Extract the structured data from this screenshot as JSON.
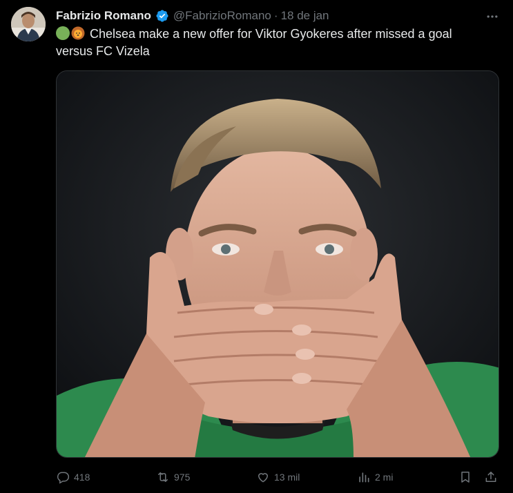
{
  "author": {
    "name": "Fabrizio Romano",
    "handle": "@FabrizioRomano",
    "separator": "·",
    "date": "18 de jan",
    "verified": true,
    "avatar_icon": "avatar-photo"
  },
  "tweet": {
    "emoji": [
      "green-circle",
      "lion-face"
    ],
    "text": "Chelsea make a new offer for Viktor Gyokeres after missed a goal versus FC Vizela",
    "media_description_icon": "player-photo"
  },
  "actions": {
    "replies": "418",
    "retweets": "975",
    "likes": "13 mil",
    "views": "2 mi"
  },
  "colors": {
    "background": "#000000",
    "text_primary": "#e7e9ea",
    "text_secondary": "#71767b",
    "verified_blue": "#1d9bf0",
    "green_emoji": "#78b159",
    "lion_emoji": "#ffac33"
  }
}
